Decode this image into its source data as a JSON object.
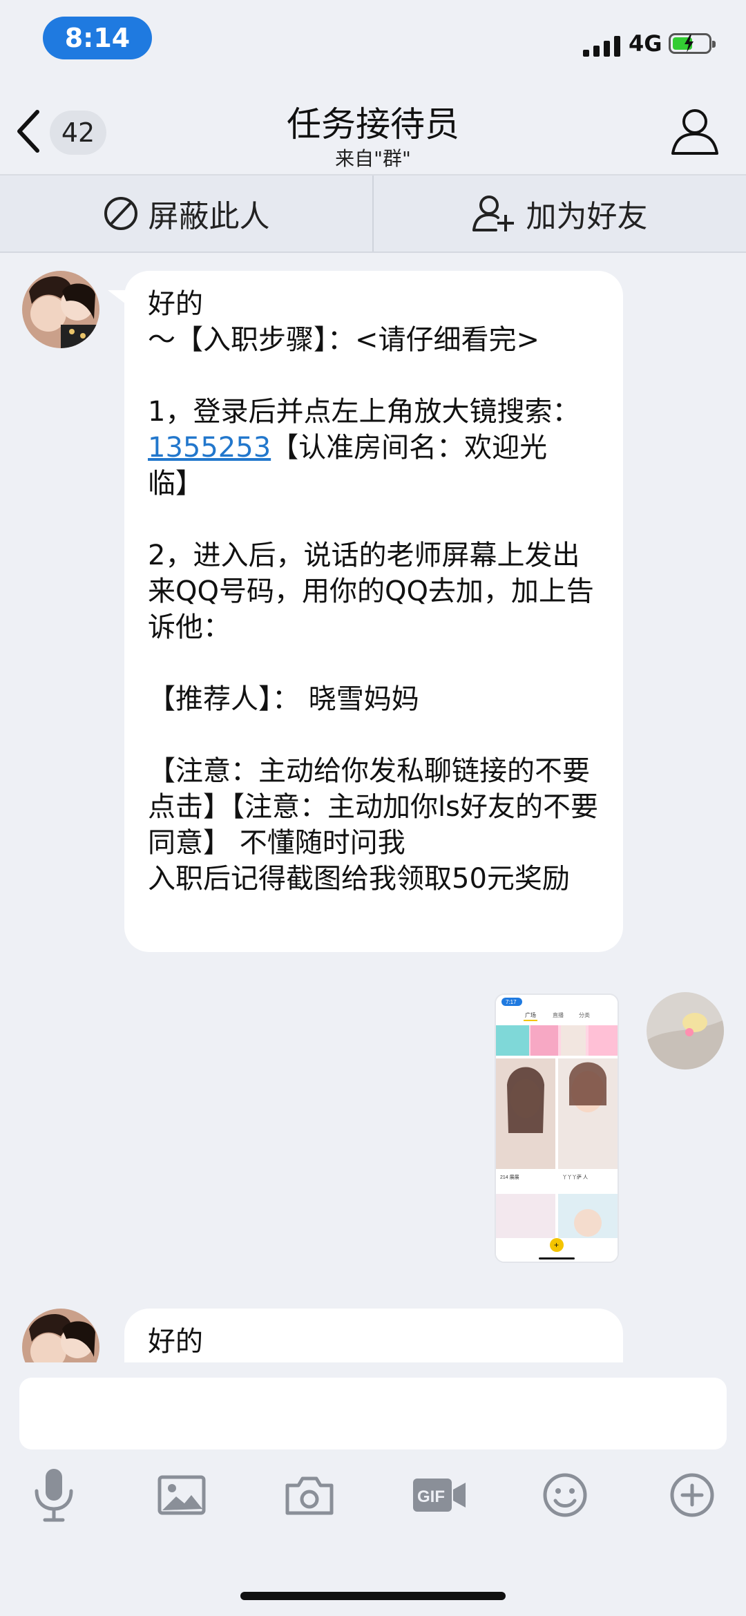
{
  "status_bar": {
    "time": "8:14",
    "network": "4G"
  },
  "nav": {
    "unread_count": "42",
    "title": "任务接待员",
    "subtitle": "来自\"群\""
  },
  "actions": {
    "block": "屏蔽此人",
    "add_friend": "加为好友"
  },
  "messages": {
    "m1": {
      "p1": "好的\n～【入职步骤】：<请仔细看完>\n\n1，登录后并点左上角放大镜搜索：",
      "link": "1355253",
      "p2": "【认准房间名：欢迎光临】\n\n2，进入后，说话的老师屏幕上发出来QQ号码，用你的QQ去加，加上告诉他：\n\n【推荐人】： 晓雪妈妈\n\n【注意：主动给你发私聊链接的不要点击】【注意：主动加你ls好友的不要同意】 不懂随时问我\n入职后记得截图给我领取50元奖励"
    },
    "m3": {
      "text": "好的"
    }
  },
  "thumbnail": {
    "time": "7:17",
    "tabs": [
      "广场",
      "直播",
      "分类"
    ],
    "caption1": "214 展展",
    "caption2": "丫丫丫萨 人"
  },
  "composer": {
    "placeholder": ""
  },
  "colors": {
    "accent": "#1f7ae0",
    "link": "#2277cc",
    "background": "#eef0f5"
  }
}
